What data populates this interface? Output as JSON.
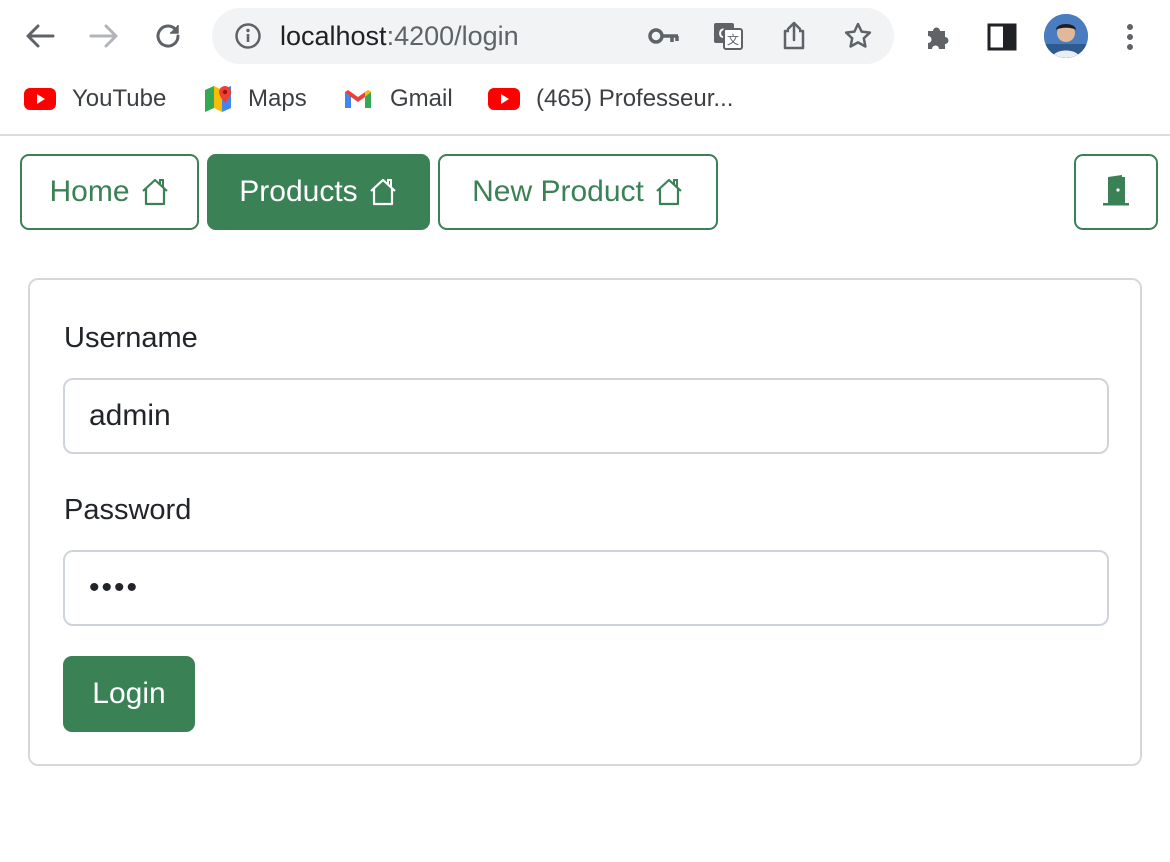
{
  "browser": {
    "url_host": "localhost",
    "url_path": ":4200/login",
    "icons": {
      "back": "back-arrow-icon",
      "forward": "forward-arrow-icon",
      "reload": "reload-icon",
      "site_info": "info-icon",
      "password": "key-icon",
      "translate": "translate-icon",
      "share": "share-icon",
      "bookmark": "star-icon",
      "extensions": "puzzle-icon",
      "side_panel": "side-panel-icon",
      "menu": "kebab-menu-icon"
    }
  },
  "bookmarks": [
    {
      "label": "YouTube",
      "icon": "youtube-icon"
    },
    {
      "label": "Maps",
      "icon": "maps-icon"
    },
    {
      "label": "Gmail",
      "icon": "gmail-icon"
    },
    {
      "label": "(465) Professeur...",
      "icon": "youtube-icon"
    }
  ],
  "navbar": {
    "items": [
      {
        "label": "Home",
        "active": false,
        "icon": "house-icon"
      },
      {
        "label": "Products",
        "active": true,
        "icon": "house-icon"
      },
      {
        "label": "New Product",
        "active": false,
        "icon": "house-icon"
      }
    ],
    "logout_icon": "door-icon"
  },
  "login_form": {
    "username_label": "Username",
    "username_value": "admin",
    "password_label": "Password",
    "password_value": "••••",
    "submit_label": "Login"
  },
  "colors": {
    "accent": "#3a8155",
    "card_border": "#d5d8db",
    "input_border": "#ced4da"
  }
}
